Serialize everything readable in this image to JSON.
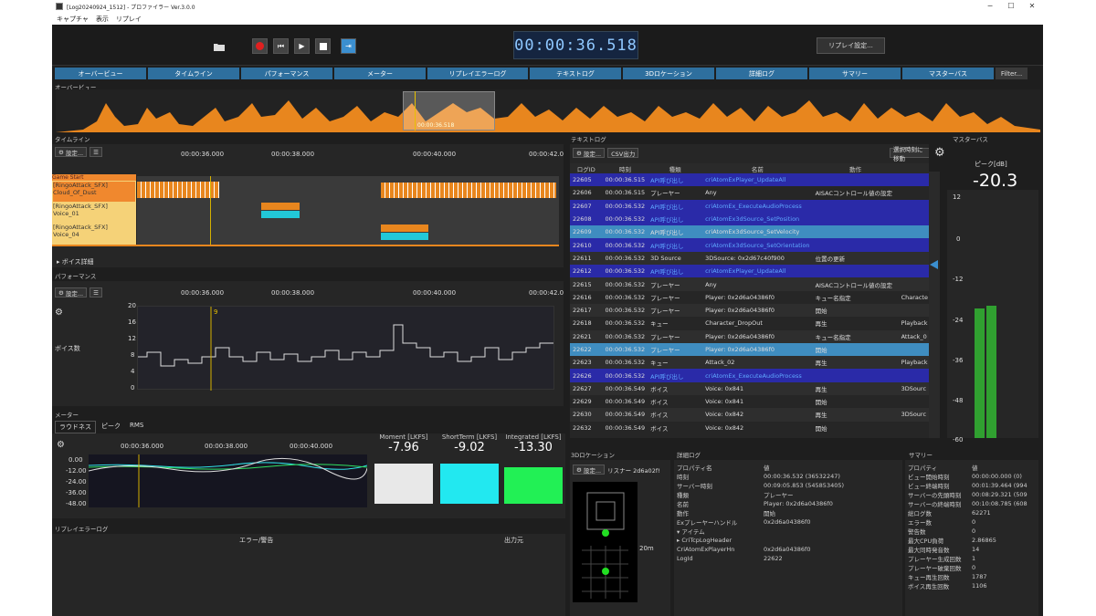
{
  "window": {
    "title": "[Log20240924_1512] - プロファイラー Ver.3.0.0",
    "min": "─",
    "max": "☐",
    "close": "✕"
  },
  "menu": [
    "キャプチャ",
    "表示",
    "リプレイ"
  ],
  "toolbar": {
    "clock": "00:00:36.518",
    "replay_settings": "リプレイ設定..."
  },
  "tabs": [
    "オーバービュー",
    "タイムライン",
    "パフォーマンス",
    "メーター",
    "リプレイエラーログ",
    "テキストログ",
    "3Dロケーション",
    "詳細ログ",
    "サマリー",
    "マスターバス",
    "Filter..."
  ],
  "overview": {
    "title": "オーバービュー",
    "marker": "00:00:36.518"
  },
  "timeline": {
    "title": "タイムライン",
    "settings": "設定...",
    "ticks": [
      "00:00:36.000",
      "00:00:38.000",
      "00:00:40.000",
      "00:00:42.0"
    ],
    "tracks": [
      "Game Start",
      "[RingoAttack_SFX]\nCloud_Of_Dust",
      "[RingoAttack_SFX]\nVoice_01",
      "[RingoAttack_SFX]\nVoice_04"
    ],
    "voice_detail": "ボイス詳細"
  },
  "performance": {
    "title": "パフォーマンス",
    "settings": "設定...",
    "ticks": [
      "00:00:36.000",
      "00:00:38.000",
      "00:00:40.000",
      "00:00:42.0"
    ],
    "ylabel": "ボイス数",
    "yticks": [
      "20",
      "16",
      "12",
      "8",
      "4",
      "0"
    ],
    "value": "9"
  },
  "meter": {
    "title": "メーター",
    "tabs": [
      "ラウドネス",
      "ピーク",
      "RMS"
    ],
    "ticks": [
      "00:00:36.000",
      "00:00:38.000",
      "00:00:40.000"
    ],
    "yticks": [
      "0.00",
      "-12.00",
      "-24.00",
      "-36.00",
      "-48.00"
    ],
    "moment_label": "Moment [LKFS]",
    "moment": "-7.96",
    "short_label": "ShortTerm [LKFS]",
    "short": "-9.02",
    "integ_label": "Integrated [LKFS]",
    "integ": "-13.30"
  },
  "replay_error": {
    "title": "リプレイエラーログ",
    "col1": "エラー/警告",
    "col2": "出力元"
  },
  "textlog": {
    "title": "テキストログ",
    "settings": "設定...",
    "csv": "CSV出力",
    "jump": "選択時刻に移動",
    "headers": [
      "ログID",
      "時刻",
      "種類",
      "名前",
      "動作",
      ""
    ],
    "rows": [
      [
        "22605",
        "00:00:36.515",
        "API呼び出し",
        "criAtomExPlayer_UpdateAll",
        "",
        ""
      ],
      [
        "22606",
        "00:00:36.515",
        "プレーヤー",
        "Any",
        "AISACコントロール値の設定",
        ""
      ],
      [
        "22607",
        "00:00:36.532",
        "API呼び出し",
        "criAtomEx_ExecuteAudioProcess",
        "",
        ""
      ],
      [
        "22608",
        "00:00:36.532",
        "API呼び出し",
        "criAtomEx3dSource_SetPosition",
        "",
        ""
      ],
      [
        "22609",
        "00:00:36.532",
        "API呼び出し",
        "criAtomEx3dSource_SetVelocity",
        "",
        ""
      ],
      [
        "22610",
        "00:00:36.532",
        "API呼び出し",
        "criAtomEx3dSource_SetOrientation",
        "",
        ""
      ],
      [
        "22611",
        "00:00:36.532",
        "3D Source",
        "3DSource: 0x2d67c40f900",
        "位置の更新",
        ""
      ],
      [
        "22612",
        "00:00:36.532",
        "API呼び出し",
        "criAtomExPlayer_UpdateAll",
        "",
        ""
      ],
      [
        "22615",
        "00:00:36.532",
        "プレーヤー",
        "Any",
        "AISACコントロール値の設定",
        ""
      ],
      [
        "22616",
        "00:00:36.532",
        "プレーヤー",
        "Player: 0x2d6a04386f0",
        "キュー名指定",
        "Characte"
      ],
      [
        "22617",
        "00:00:36.532",
        "プレーヤー",
        "Player: 0x2d6a04386f0",
        "開始",
        ""
      ],
      [
        "22618",
        "00:00:36.532",
        "キュー",
        "Character_DropOut",
        "再生",
        "Playback"
      ],
      [
        "22621",
        "00:00:36.532",
        "プレーヤー",
        "Player: 0x2d6a04386f0",
        "キュー名指定",
        "Attack_0"
      ],
      [
        "22622",
        "00:00:36.532",
        "プレーヤー",
        "Player: 0x2d6a04386f0",
        "開始",
        ""
      ],
      [
        "22623",
        "00:00:36.532",
        "キュー",
        "Attack_02",
        "再生",
        "Playback"
      ],
      [
        "22626",
        "00:00:36.532",
        "API呼び出し",
        "criAtomEx_ExecuteAudioProcess",
        "",
        ""
      ],
      [
        "22627",
        "00:00:36.549",
        "ボイス",
        "Voice: 0x841",
        "再生",
        "3DSourc"
      ],
      [
        "22629",
        "00:00:36.549",
        "ボイス",
        "Voice: 0x841",
        "開始",
        ""
      ],
      [
        "22630",
        "00:00:36.549",
        "ボイス",
        "Voice: 0x842",
        "再生",
        "3DSourc"
      ],
      [
        "22632",
        "00:00:36.549",
        "ボイス",
        "Voice: 0x842",
        "開始",
        ""
      ]
    ]
  },
  "masterbus": {
    "title": "マスターバス",
    "peak_label": "ピーク[dB]",
    "peak": "-20.3",
    "scale": [
      "12",
      "0",
      "-12",
      "-24",
      "-36",
      "-48",
      "-60"
    ],
    "level": -23
  },
  "loc3d": {
    "title": "3Dロケーション",
    "settings": "設定...",
    "listener": "リスナー 2d6a02f!",
    "dist": "20m"
  },
  "detail": {
    "title": "詳細ログ",
    "headers": [
      "プロパティ名",
      "値"
    ],
    "rows": [
      [
        "時刻",
        "00:00:36.532 (36532247)"
      ],
      [
        "サーバー時刻",
        "00:09:05.853 (545853405)"
      ],
      [
        "種類",
        "プレーヤー"
      ],
      [
        "名前",
        "Player: 0x2d6a04386f0"
      ],
      [
        "動作",
        "開始"
      ],
      [
        "Exプレーヤーハンドル",
        "0x2d6a04386f0"
      ],
      [
        "▾ アイテム",
        ""
      ],
      [
        "▸ CriTcpLogHeader",
        ""
      ],
      [
        "CriAtomExPlayerHn",
        "0x2d6a04386f0"
      ],
      [
        "LogId",
        "22622"
      ]
    ]
  },
  "summary": {
    "title": "サマリー",
    "headers": [
      "プロパティ",
      "値"
    ],
    "rows": [
      [
        "ビュー開始時刻",
        "00:00:00.000 (0)"
      ],
      [
        "ビュー終端時刻",
        "00:01:39.464 (994"
      ],
      [
        "サーバーの先頭時刻",
        "00:08:29.321 (509"
      ],
      [
        "サーバーの終端時刻",
        "00:10:08.785 (608"
      ],
      [
        "総ログ数",
        "62271"
      ],
      [
        "エラー数",
        "0"
      ],
      [
        "警告数",
        "0"
      ],
      [
        "最大CPU負荷",
        "2.86865"
      ],
      [
        "最大同時発音数",
        "14"
      ],
      [
        "プレーヤー生成回数",
        "1"
      ],
      [
        "プレーヤー破棄回数",
        "0"
      ],
      [
        "キュー再生回数",
        "1787"
      ],
      [
        "ボイス再生回数",
        "1106"
      ]
    ]
  }
}
